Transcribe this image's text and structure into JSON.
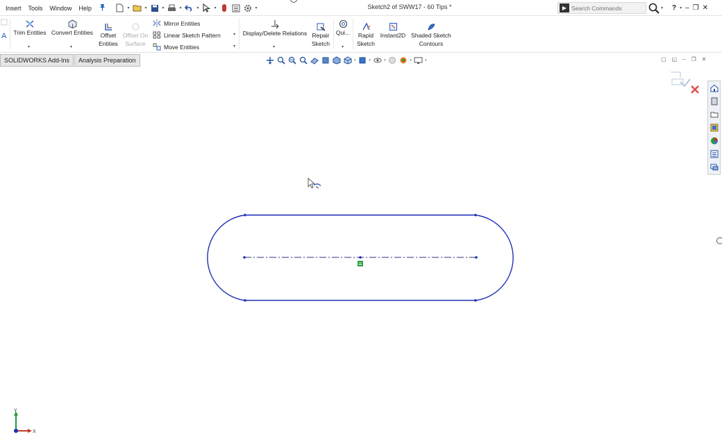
{
  "menu": {
    "items": [
      "Insert",
      "Tools",
      "Window",
      "Help"
    ]
  },
  "titlebar": {
    "document_title": "Sketch2 of SWW17 - 60 Tips *"
  },
  "search": {
    "placeholder": "Search Commands"
  },
  "window_controls": {
    "help": "?",
    "minimize": "–",
    "restore": "❐",
    "close": "✕"
  },
  "command_manager": {
    "trim_entities": "Trim Entities",
    "convert_entities": "Convert Entities",
    "offset_entities_line1": "Offset",
    "offset_entities_line2": "Entities",
    "offset_on_surface_line1": "Offset On",
    "offset_on_surface_line2": "Surface",
    "mirror_entities": "Mirror Entities",
    "linear_sketch_pattern": "Linear Sketch Pattern",
    "move_entities": "Move Entities",
    "display_delete_relations": "Display/Delete Relations",
    "repair_sketch_line1": "Repair",
    "repair_sketch_line2": "Sketch",
    "quick_snaps": "Qui...",
    "rapid_sketch_line1": "Rapid",
    "rapid_sketch_line2": "Sketch",
    "instant2d": "Instant2D",
    "shaded_sketch_line1": "Shaded Sketch",
    "shaded_sketch_line2": "Contours"
  },
  "tabs": {
    "addins": "SOLIDWORKS Add-Ins",
    "analysis": "Analysis Preparation"
  },
  "triad": {
    "y": "Y",
    "x": "X"
  },
  "colors": {
    "sketch_blue": "#1c2fb5",
    "centerline": "#3a2a80",
    "relation_green": "#1f9a3a",
    "reject_red": "#e05050"
  }
}
